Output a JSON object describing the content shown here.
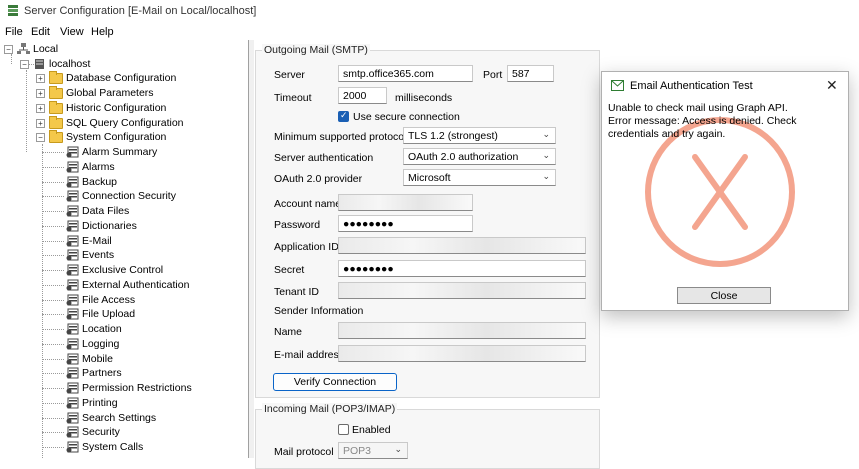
{
  "window": {
    "title": "Server Configuration [E-Mail on Local/localhost]",
    "menu": [
      "File",
      "Edit",
      "View",
      "Help"
    ]
  },
  "tree": {
    "root": "Local",
    "host": "localhost",
    "folders": [
      "Database Configuration",
      "Global Parameters",
      "Historic Configuration",
      "SQL Query Configuration",
      "System Configuration"
    ],
    "system_items": [
      "Alarm Summary",
      "Alarms",
      "Backup",
      "Connection Security",
      "Data Files",
      "Dictionaries",
      "E-Mail",
      "Events",
      "Exclusive Control",
      "External Authentication",
      "File Access",
      "File Upload",
      "Location",
      "Logging",
      "Mobile",
      "Partners",
      "Permission Restrictions",
      "Printing",
      "Search Settings",
      "Security",
      "System Calls"
    ]
  },
  "smtp": {
    "group_title": "Outgoing Mail (SMTP)",
    "server_label": "Server",
    "server_value": "smtp.office365.com",
    "port_label": "Port",
    "port_value": "587",
    "timeout_label": "Timeout",
    "timeout_value": "2000",
    "timeout_unit": "milliseconds",
    "secure_label": "Use secure connection",
    "secure_checked": true,
    "min_protocol_label": "Minimum supported protocol",
    "min_protocol_value": "TLS 1.2 (strongest)",
    "server_auth_label": "Server authentication",
    "server_auth_value": "OAuth 2.0 authorization",
    "oauth_provider_label": "OAuth 2.0 provider",
    "oauth_provider_value": "Microsoft",
    "account_label": "Account name",
    "password_label": "Password",
    "password_value": "●●●●●●●●",
    "app_id_label": "Application ID",
    "secret_label": "Secret",
    "secret_value": "●●●●●●●●",
    "tenant_label": "Tenant ID",
    "sender_info_label": "Sender Information",
    "name_label": "Name",
    "email_label": "E-mail address",
    "verify_button": "Verify Connection"
  },
  "incoming": {
    "group_title": "Incoming Mail (POP3/IMAP)",
    "enabled_label": "Enabled",
    "enabled_checked": false,
    "protocol_label": "Mail protocol",
    "protocol_value": "POP3"
  },
  "dialog": {
    "title": "Email Authentication Test",
    "line1": "Unable to check mail using Graph API.",
    "line2": "Error message: Access is denied. Check credentials and try again.",
    "close_button": "Close",
    "close_icon": "✕",
    "error_color": "#f4a58f"
  }
}
